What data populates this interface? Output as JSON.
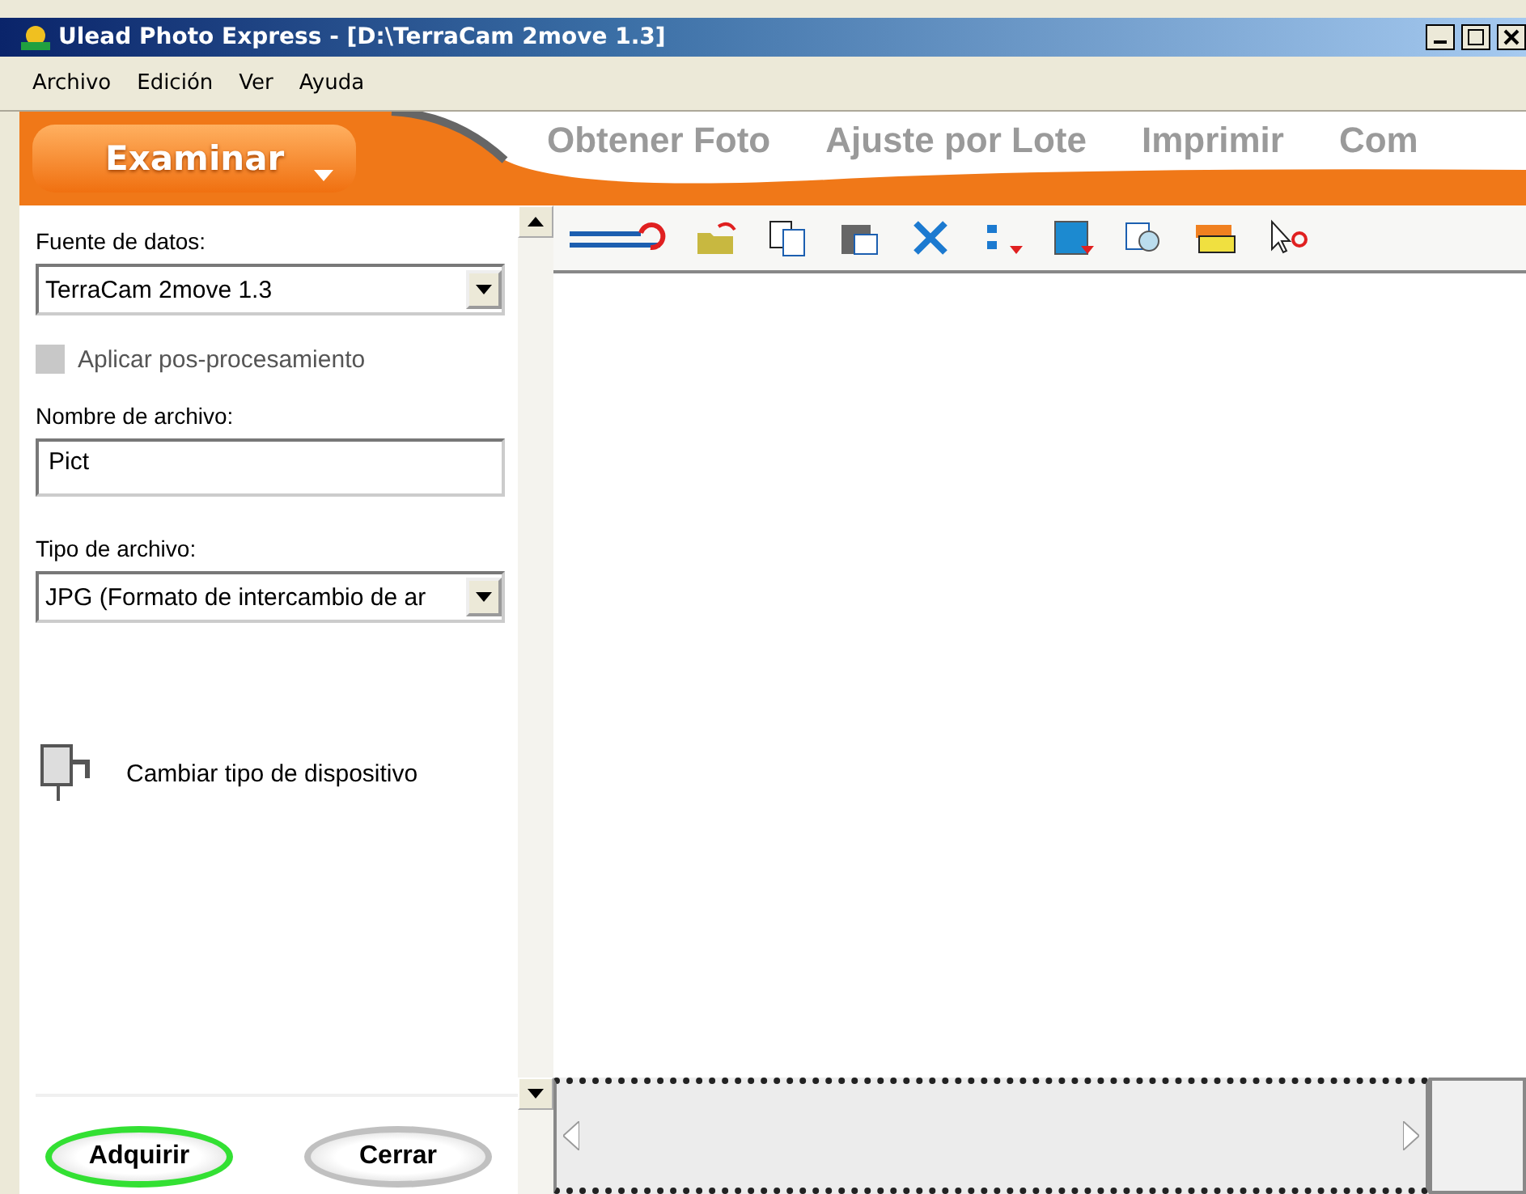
{
  "window": {
    "title": "Ulead Photo Express - [D:\\TerraCam 2move 1.3]"
  },
  "menu": [
    "Archivo",
    "Edición",
    "Ver",
    "Ayuda"
  ],
  "tabs": [
    {
      "label": "Examinar",
      "selected": true
    },
    {
      "label": "Obtener Foto",
      "selected": false
    },
    {
      "label": "Ajuste por Lote",
      "selected": false
    },
    {
      "label": "Imprimir",
      "selected": false
    },
    {
      "label": "Com",
      "selected": false
    }
  ],
  "panel": {
    "source_label": "Fuente de datos:",
    "source_value": "TerraCam 2move 1.3",
    "post_process": {
      "label": "Aplicar pos-procesamiento",
      "checked": false,
      "disabled": true
    },
    "filename_label": "Nombre de archivo:",
    "filename_value": "Pict",
    "filetype_label": "Tipo de archivo:",
    "filetype_value": "JPG (Formato de intercambio de ar",
    "device_link": "Cambiar tipo de dispositivo"
  },
  "buttons": [
    {
      "label": "Adquirir",
      "kind": "primary"
    },
    {
      "label": "Cerrar",
      "kind": "secondary"
    }
  ]
}
